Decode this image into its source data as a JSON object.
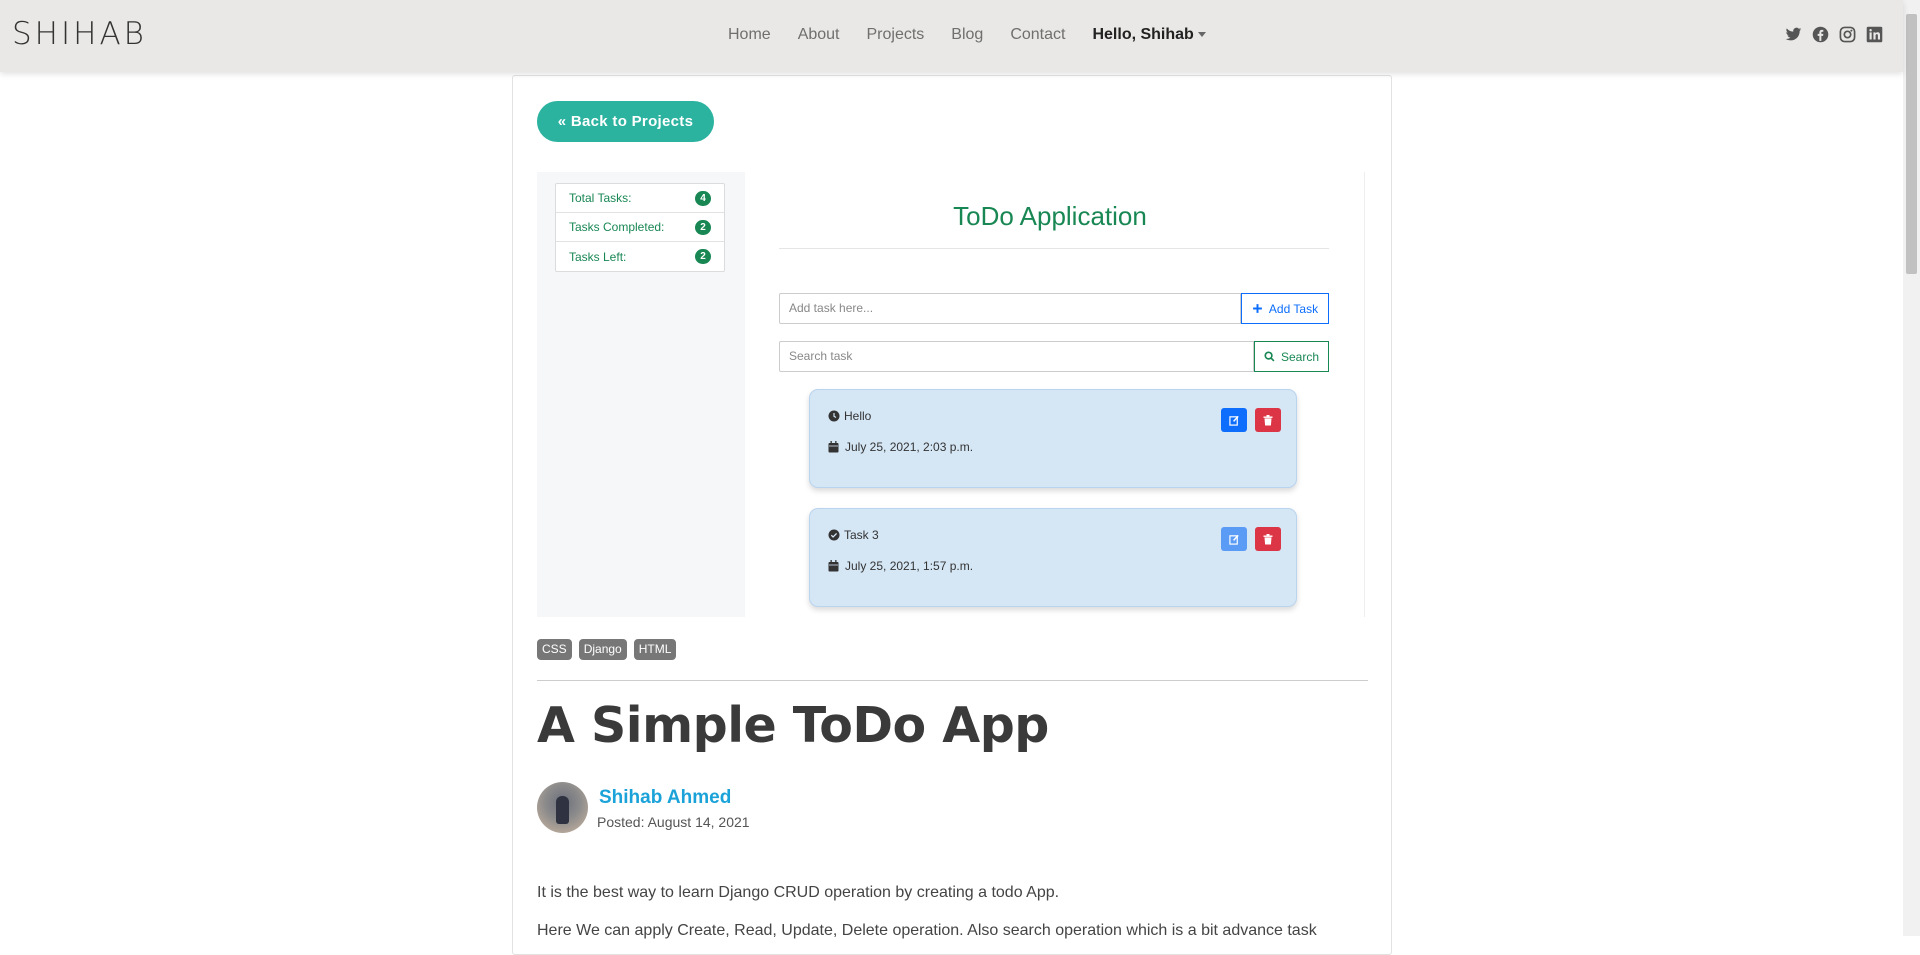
{
  "navbar": {
    "brand": "SHIHAB",
    "links": [
      "Home",
      "About",
      "Projects",
      "Blog",
      "Contact"
    ],
    "user_menu": "Hello, Shihab",
    "social_icons": [
      "twitter-icon",
      "facebook-icon",
      "instagram-icon",
      "linkedin-icon"
    ]
  },
  "back_button": "« Back to Projects",
  "todo_screenshot": {
    "stats": [
      {
        "label": "Total Tasks:",
        "count": "4"
      },
      {
        "label": "Tasks Completed:",
        "count": "2"
      },
      {
        "label": "Tasks Left:",
        "count": "2"
      }
    ],
    "title": "ToDo Application",
    "add_placeholder": "Add task here...",
    "add_button": "Add Task",
    "search_placeholder": "Search task",
    "search_button": "Search",
    "tasks": [
      {
        "title": "Hello",
        "date": "July 25, 2021, 2:03 p.m.",
        "status_icon": "clock-icon"
      },
      {
        "title": "Task 3",
        "date": "July 25, 2021, 1:57 p.m.",
        "status_icon": "check-circle-icon"
      }
    ]
  },
  "tags": [
    "CSS",
    "Django",
    "HTML"
  ],
  "post": {
    "title": "A Simple ToDo App",
    "author": "Shihab Ahmed",
    "posted": "Posted: August 14, 2021",
    "paragraphs": [
      "It is the best way to learn Django CRUD operation by creating a todo App.",
      "Here We can apply Create, Read, Update, Delete operation. Also search operation which is a bit advance task"
    ]
  },
  "colors": {
    "accent": "#2bb3a0",
    "todo_green": "#198754",
    "primary_blue": "#0d6efd",
    "danger_red": "#dc3545",
    "author_link": "#1ba3d9"
  }
}
